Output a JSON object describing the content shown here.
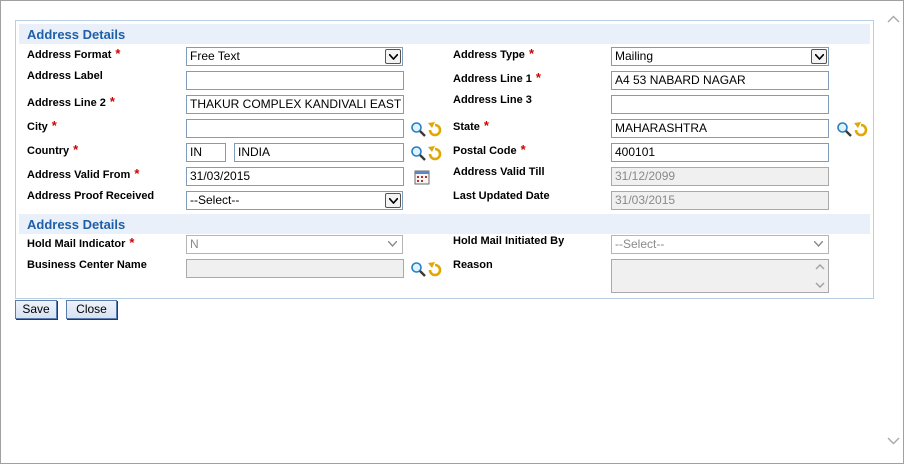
{
  "sections": [
    {
      "title": "Address Details"
    },
    {
      "title": "Address Details"
    }
  ],
  "fields": {
    "address_format": {
      "label": "Address Format",
      "value": "Free Text"
    },
    "address_type": {
      "label": "Address Type",
      "value": "Mailing"
    },
    "address_label": {
      "label": "Address Label",
      "value": ""
    },
    "address_line1": {
      "label": "Address Line 1",
      "value": "A4  53 NABARD NAGAR"
    },
    "address_line2": {
      "label": "Address Line 2",
      "value": "THAKUR COMPLEX KANDIVALI EAST"
    },
    "address_line3": {
      "label": "Address Line 3",
      "value": ""
    },
    "city": {
      "label": "City",
      "value": ""
    },
    "state": {
      "label": "State",
      "value": "MAHARASHTRA"
    },
    "country": {
      "label": "Country",
      "code": "IN",
      "value": "INDIA"
    },
    "postal_code": {
      "label": "Postal Code",
      "value": "400101"
    },
    "valid_from": {
      "label": "Address Valid From",
      "value": "31/03/2015"
    },
    "valid_till": {
      "label": "Address Valid Till",
      "value": "31/12/2099"
    },
    "proof_received": {
      "label": "Address Proof Received",
      "value": "--Select--"
    },
    "last_updated": {
      "label": "Last Updated Date",
      "value": "31/03/2015"
    },
    "hold_mail_indicator": {
      "label": "Hold Mail Indicator",
      "value": "N"
    },
    "hold_mail_initiated_by": {
      "label": "Hold Mail Initiated By",
      "value": "--Select--"
    },
    "business_center_name": {
      "label": "Business Center Name",
      "value": ""
    },
    "reason": {
      "label": "Reason",
      "value": ""
    }
  },
  "buttons": {
    "save": "Save",
    "close": "Close"
  },
  "colors": {
    "section_title": "#1f5fa8",
    "required": "#d40000",
    "section_bg": "#e9f0f9"
  }
}
